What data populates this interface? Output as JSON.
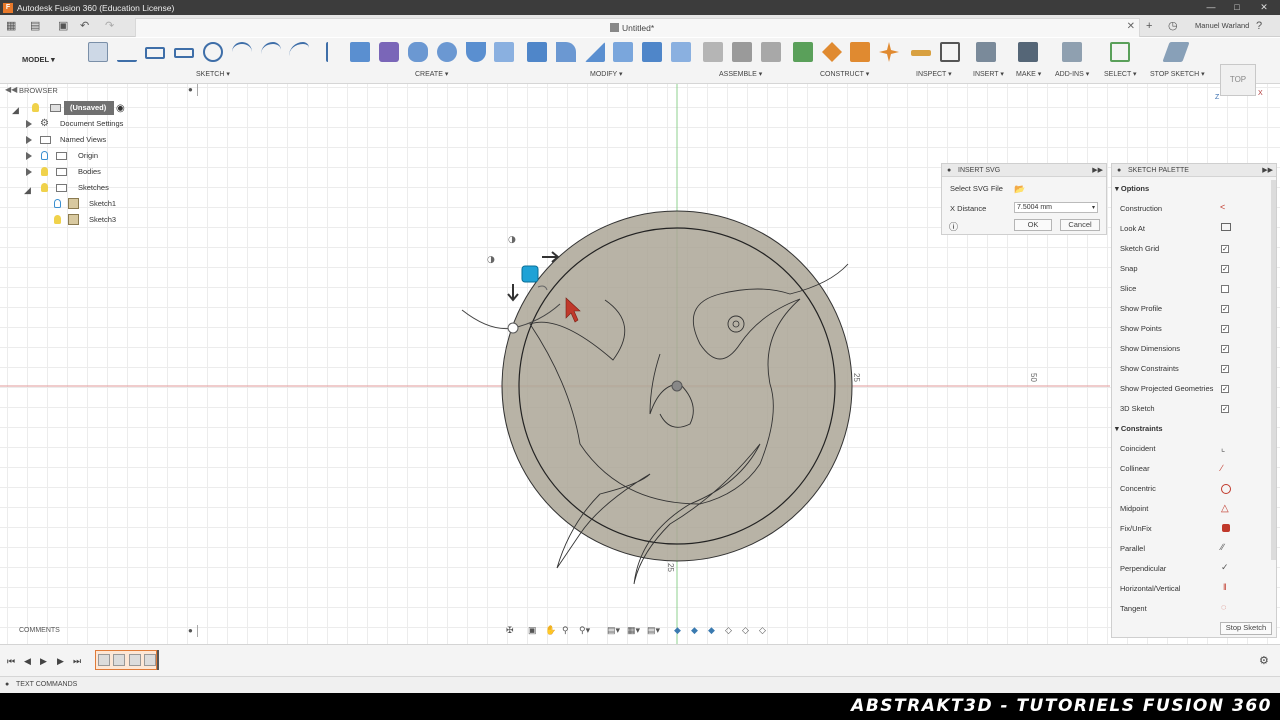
{
  "window": {
    "title": "Autodesk Fusion 360 (Education License)"
  },
  "tab": {
    "document_title": "Untitled*",
    "user_name": "Manuel Warland"
  },
  "toolbar": {
    "workspace": "MODEL",
    "groups": [
      "SKETCH",
      "CREATE",
      "MODIFY",
      "ASSEMBLE",
      "CONSTRUCT",
      "INSPECT",
      "INSERT",
      "MAKE",
      "ADD-INS",
      "SELECT",
      "STOP SKETCH"
    ]
  },
  "browser": {
    "header": "BROWSER",
    "root": "(Unsaved)",
    "items": [
      "Document Settings",
      "Named Views",
      "Origin",
      "Bodies",
      "Sketches",
      "Sketch1",
      "Sketch3"
    ]
  },
  "viewcube": {
    "label": "TOP"
  },
  "canvas": {
    "dim_label_1": "25",
    "dim_label_2": "50",
    "dim_label_3": "25"
  },
  "insert_svg": {
    "title": "INSERT SVG",
    "select_label": "Select SVG File",
    "x_distance_label": "X Distance",
    "x_distance_value": "7.5004 mm",
    "ok": "OK",
    "cancel": "Cancel"
  },
  "sketch_palette": {
    "title": "SKETCH PALETTE",
    "options_header": "Options",
    "options": [
      {
        "label": "Construction",
        "type": "icon"
      },
      {
        "label": "Look At",
        "type": "icon"
      },
      {
        "label": "Sketch Grid",
        "type": "check",
        "checked": true
      },
      {
        "label": "Snap",
        "type": "check",
        "checked": true
      },
      {
        "label": "Slice",
        "type": "check",
        "checked": false
      },
      {
        "label": "Show Profile",
        "type": "check",
        "checked": true
      },
      {
        "label": "Show Points",
        "type": "check",
        "checked": true
      },
      {
        "label": "Show Dimensions",
        "type": "check",
        "checked": true
      },
      {
        "label": "Show Constraints",
        "type": "check",
        "checked": true
      },
      {
        "label": "Show Projected Geometries",
        "type": "check",
        "checked": true
      },
      {
        "label": "3D Sketch",
        "type": "check",
        "checked": true
      }
    ],
    "constraints_header": "Constraints",
    "constraints": [
      "Coincident",
      "Collinear",
      "Concentric",
      "Midpoint",
      "Fix/UnFix",
      "Parallel",
      "Perpendicular",
      "Horizontal/Vertical",
      "Tangent"
    ],
    "stop_sketch": "Stop Sketch"
  },
  "comments": {
    "label": "COMMENTS"
  },
  "text_commands": {
    "label": "TEXT COMMANDS"
  },
  "banner": {
    "text": "ABSTRAKT3D - TUTORIELS FUSION 360"
  },
  "colors": {
    "accent_red": "#c0392b",
    "sketch_fill": "#aca697",
    "grid": "#ececec",
    "highlight_blue": "#1fa2d6"
  }
}
